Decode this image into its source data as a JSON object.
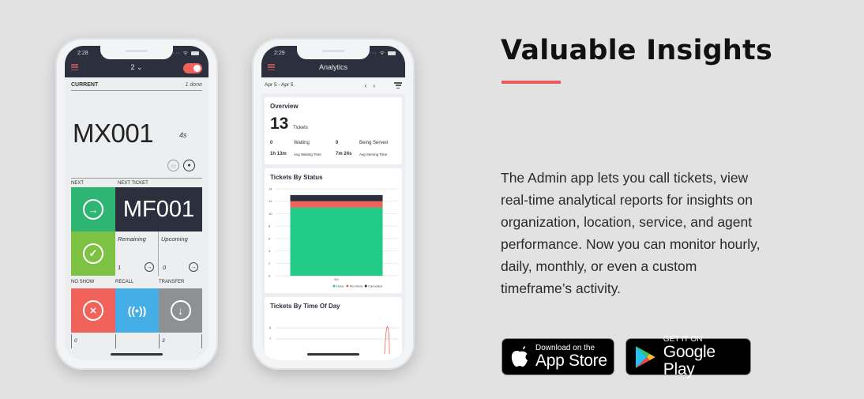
{
  "headline": "Valuable Insights",
  "description": "The Admin app lets you call tickets, view real-time analytical reports for insights on organization, location, service, and agent performance. Now you can monitor hourly, daily, monthly, or even a custom timeframe’s activity.",
  "colors": {
    "accent": "#e85c5a",
    "background": "#e2e2e2",
    "app_header": "#2c2f3d",
    "done": "#22cc88",
    "no_show": "#f0625a",
    "cancelled": "#2c2f3d",
    "next_green": "#2eb574",
    "serve_green": "#7dc242",
    "recall_blue": "#45aee6",
    "transfer_gray": "#8e9194"
  },
  "store_buttons": {
    "app_store": {
      "small": "Download on the",
      "big": "App Store",
      "icon": "apple-icon"
    },
    "google_play": {
      "small": "GET IT ON",
      "big": "Google Play",
      "icon": "google-play-icon"
    }
  },
  "phone1": {
    "status_time": "2:28",
    "counter_selector": "2 ⌄",
    "toggle_on": true,
    "current_label": "CURRENT",
    "done_count": "1 done",
    "current_ticket": "MX001",
    "elapsed": "4s",
    "next_label": "NEXT",
    "next_ticket_label": "NEXT TICKET",
    "next_ticket": "MF001",
    "remaining_label": "Remaining",
    "remaining_value": "1",
    "upcoming_label": "Upcoming",
    "upcoming_value": "0",
    "no_show_label": "NO SHOW",
    "recall_label": "RECALL",
    "transfer_label": "TRANSFER",
    "no_show_count": "0",
    "recall_count": "",
    "transfer_count": "3"
  },
  "phone2": {
    "status_time": "2:29",
    "title": "Analytics",
    "date_range": "Apr 5 - Apr 5",
    "prev": "‹",
    "next": "›",
    "overview": {
      "title": "Overview",
      "total": "13",
      "total_label": "Tickets",
      "waiting": "0",
      "waiting_label": "Waiting",
      "being_served": "0",
      "being_served_label": "Being Served",
      "avg_wait": "1h 13m",
      "avg_wait_label": "Avg Waiting Time",
      "avg_serve": "7m 24s",
      "avg_serve_label": "Avg Serving Time"
    },
    "time_of_day_title": "Tickets By Time Of Day",
    "time_of_day_ticks": [
      "8",
      "7"
    ]
  },
  "chart_data": {
    "type": "bar",
    "title": "Tickets By Status",
    "categories": [
      "5/4"
    ],
    "series": [
      {
        "name": "Done",
        "values": [
          11
        ],
        "color": "#22cc88"
      },
      {
        "name": "No-Show",
        "values": [
          1
        ],
        "color": "#f0625a"
      },
      {
        "name": "Cancelled",
        "values": [
          1
        ],
        "color": "#2c2f3d"
      }
    ],
    "stacked": true,
    "ylim": [
      0,
      14
    ],
    "yticks": [
      0,
      2,
      4,
      6,
      8,
      10,
      12,
      14
    ],
    "grid": true,
    "legend": "bottom-right",
    "xlabel": "",
    "ylabel": ""
  }
}
